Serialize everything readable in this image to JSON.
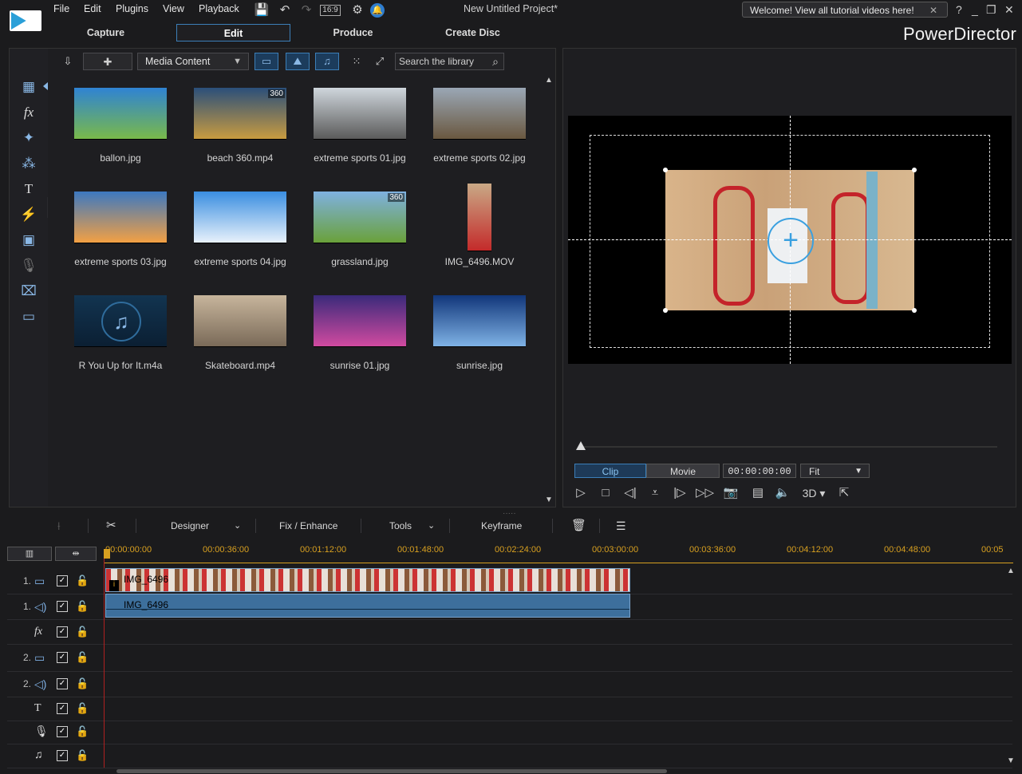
{
  "menu": [
    "File",
    "Edit",
    "Plugins",
    "View",
    "Playback"
  ],
  "aspect": "16:9",
  "project_title": "New Untitled Project*",
  "welcome": "Welcome! View all tutorial videos here!",
  "window_controls": [
    "?",
    "_",
    "❐",
    "✕"
  ],
  "modes": [
    "Capture",
    "Edit",
    "Produce",
    "Create Disc"
  ],
  "brand": "PowerDirector",
  "library": {
    "media_select": "Media Content",
    "search_placeholder": "Search the library",
    "items": [
      {
        "label": "ballon.jpg",
        "colors": [
          "#2f83d3",
          "#79b94a"
        ],
        "badge": ""
      },
      {
        "label": "beach 360.mp4",
        "colors": [
          "#2b4f7a",
          "#c89b40"
        ],
        "badge": "360"
      },
      {
        "label": "extreme sports 01.jpg",
        "colors": [
          "#cfd6dc",
          "#5b5b5b"
        ],
        "badge": ""
      },
      {
        "label": "extreme sports 02.jpg",
        "colors": [
          "#9aa7b5",
          "#6a5840"
        ],
        "badge": ""
      },
      {
        "label": "extreme sports 03.jpg",
        "colors": [
          "#3c78c0",
          "#f3a043"
        ],
        "badge": ""
      },
      {
        "label": "extreme sports 04.jpg",
        "colors": [
          "#3a8ee0",
          "#e8f1fb"
        ],
        "badge": ""
      },
      {
        "label": "grassland.jpg",
        "colors": [
          "#7fb1e0",
          "#6aa13a"
        ],
        "badge": "360"
      },
      {
        "label": "IMG_6496.MOV",
        "colors": [
          "#c9a986",
          "#c42a2a"
        ],
        "badge": ""
      },
      {
        "label": "R You Up for It.m4a",
        "colors": [
          "#123450",
          "#0b1f33"
        ],
        "badge": ""
      },
      {
        "label": "Skateboard.mp4",
        "colors": [
          "#c7b59c",
          "#7a6a58"
        ],
        "badge": ""
      },
      {
        "label": "sunrise 01.jpg",
        "colors": [
          "#3a2a7a",
          "#d14aa0"
        ],
        "badge": ""
      },
      {
        "label": "sunrise.jpg",
        "colors": [
          "#11367a",
          "#7fb2e5"
        ],
        "badge": ""
      }
    ]
  },
  "preview": {
    "clip_tab": "Clip",
    "movie_tab": "Movie",
    "timecode": "00:00:00:00",
    "fit": "Fit",
    "three_d": "3D"
  },
  "edit_toolbar": {
    "designer": "Designer",
    "fix_enhance": "Fix / Enhance",
    "tools": "Tools",
    "keyframe": "Keyframe"
  },
  "ruler_ticks": [
    "00:00:00:00",
    "00:00:36:00",
    "00:01:12:00",
    "00:01:48:00",
    "00:02:24:00",
    "00:03:00:00",
    "00:03:36:00",
    "00:04:12:00",
    "00:04:48:00",
    "00:05"
  ],
  "tracks": [
    {
      "num": "1.",
      "icon": "video-track-icon",
      "glyph": "▭"
    },
    {
      "num": "1.",
      "icon": "audio-track-icon",
      "glyph": "◁)"
    },
    {
      "num": "",
      "icon": "fx-track-icon",
      "glyph": "fx"
    },
    {
      "num": "2.",
      "icon": "video-track-icon",
      "glyph": "▭"
    },
    {
      "num": "2.",
      "icon": "audio-track-icon",
      "glyph": "◁)"
    },
    {
      "num": "",
      "icon": "title-track-icon",
      "glyph": "T"
    },
    {
      "num": "",
      "icon": "voice-track-icon",
      "glyph": "🎙"
    },
    {
      "num": "",
      "icon": "music-track-icon",
      "glyph": "♫"
    }
  ],
  "clips": {
    "video_name": "IMG_6496",
    "audio_name": "IMG_6496"
  },
  "colors": {
    "accent": "#3c7fb8",
    "ruler": "#d8a020",
    "playhead": "#b02020"
  }
}
